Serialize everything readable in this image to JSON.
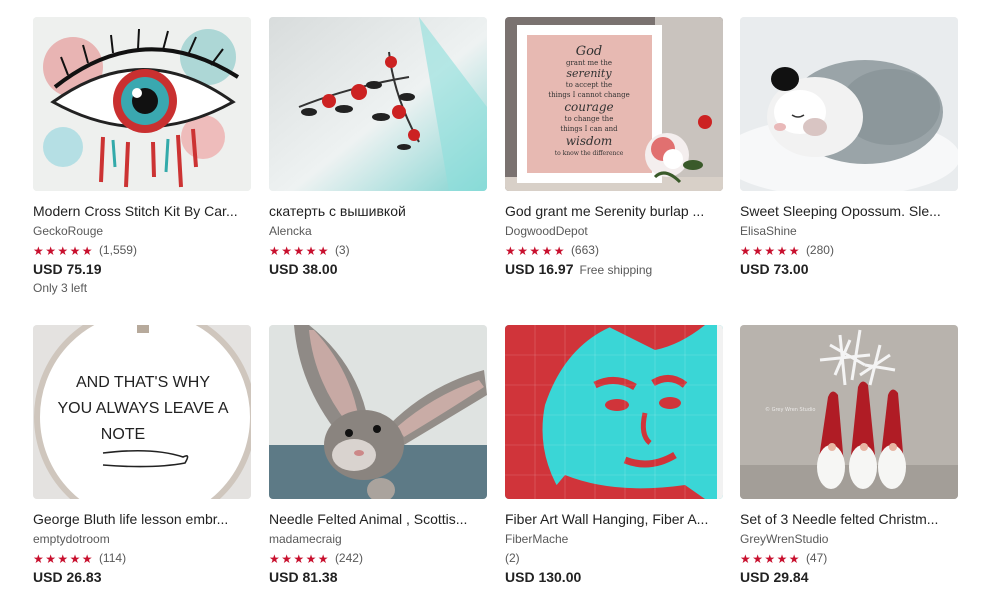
{
  "listings": [
    {
      "title": "Modern Cross Stitch Kit By Car...",
      "shop": "GeckoRouge",
      "rating": 5,
      "reviews": "(1,559)",
      "price": "USD 75.19",
      "shipping": "",
      "extra": "Only 3 left",
      "image": "eye-splatter-image"
    },
    {
      "title": "скатерть с вышивкой",
      "shop": "Alencka",
      "rating": 5,
      "reviews": "(3)",
      "price": "USD 38.00",
      "shipping": "",
      "extra": "",
      "image": "embroidered-roses-tablecloth-image"
    },
    {
      "title": "God grant me Serenity burlap ...",
      "shop": "DogwoodDepot",
      "rating": 5,
      "reviews": "(663)",
      "price": "USD 16.97",
      "shipping": "Free shipping",
      "extra": "",
      "image": "serenity-prayer-frame-image"
    },
    {
      "title": "Sweet Sleeping Opossum. Sle...",
      "shop": "ElisaShine",
      "rating": 5,
      "reviews": "(280)",
      "price": "USD 73.00",
      "shipping": "",
      "extra": "",
      "image": "felted-opossum-image"
    },
    {
      "title": "George Bluth life lesson embr...",
      "shop": "emptydotroom",
      "rating": 5,
      "reviews": "(114)",
      "price": "USD 26.83",
      "shipping": "",
      "extra": "",
      "image": "hoop-note-image"
    },
    {
      "title": "Needle Felted Animal , Scottis...",
      "shop": "madamecraig",
      "rating": 5,
      "reviews": "(242)",
      "price": "USD 81.38",
      "shipping": "",
      "extra": "",
      "image": "felted-hare-image"
    },
    {
      "title": "Fiber Art Wall Hanging, Fiber A...",
      "shop": "FiberMache",
      "rating": 0,
      "reviews": "(2)",
      "price": "USD 130.00",
      "shipping": "",
      "extra": "",
      "image": "red-cyan-portrait-image"
    },
    {
      "title": "Set of 3 Needle felted Christm...",
      "shop": "GreyWrenStudio",
      "rating": 5,
      "reviews": "(47)",
      "price": "USD 29.84",
      "shipping": "",
      "extra": "",
      "image": "christmas-gnomes-image"
    }
  ],
  "hoop_text": [
    "AND THAT'S WHY",
    "YOU ALWAYS LEAVE A",
    "NOTE"
  ],
  "serenity_text": [
    "God",
    "grant me the",
    "serenity",
    "to accept the",
    "things I cannot change",
    "courage",
    "to change the",
    "things I can and",
    "wisdom",
    "to know the difference"
  ],
  "gnome_watermark": "© Grey Wren Studio",
  "colors": {
    "star": "#c8102e",
    "accent_red": "#d0343a",
    "cyan": "#3ad6d6"
  }
}
